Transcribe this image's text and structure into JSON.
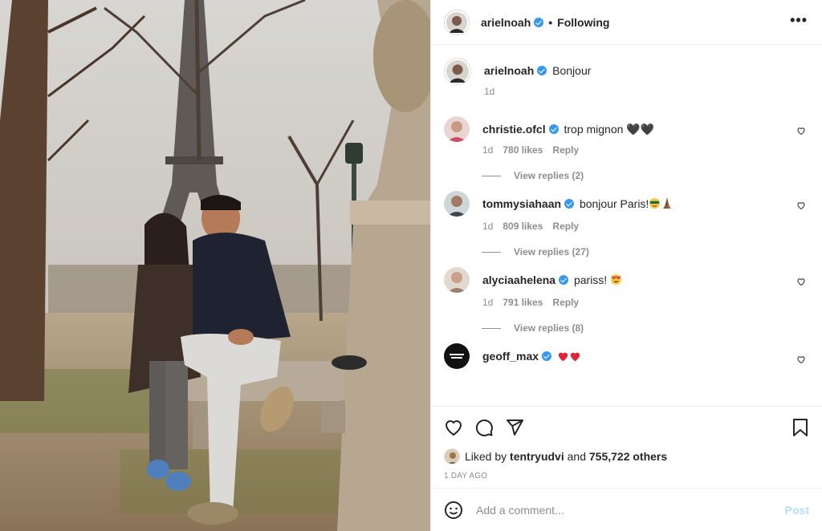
{
  "header": {
    "username": "arielnoah",
    "separator": "•",
    "follow_status": "Following",
    "more_label": "•••"
  },
  "caption": {
    "username": "arielnoah",
    "text": "Bonjour",
    "age": "1d"
  },
  "comments": [
    {
      "username": "christie.ofcl",
      "text": "trop mignon 🖤🖤",
      "age": "1d",
      "likes": "780 likes",
      "reply_label": "Reply",
      "view_replies": "View replies (2)",
      "verified": true
    },
    {
      "username": "tommysiahaan",
      "text": "bonjour Paris!",
      "age": "1d",
      "likes": "809 likes",
      "reply_label": "Reply",
      "view_replies": "View replies (27)",
      "verified": true
    },
    {
      "username": "alyciaahelena",
      "text": "pariss!",
      "age": "1d",
      "likes": "791 likes",
      "reply_label": "Reply",
      "view_replies": "View replies (8)",
      "verified": true
    },
    {
      "username": "geoff_max",
      "text": "",
      "verified": true
    }
  ],
  "likes": {
    "prefix": "Liked by",
    "user": "tentryudvi",
    "conj": "and",
    "others": "755,722 others"
  },
  "timestamp": "1 DAY AGO",
  "add_comment": {
    "placeholder": "Add a comment...",
    "post_label": "Post"
  },
  "colors": {
    "verified": "#3897f0",
    "post_disabled": "#b2dffc",
    "muted": "#8e8e8e",
    "heart_red": "#ed4956"
  },
  "icons": [
    "heart-icon",
    "comment-icon",
    "share-icon",
    "bookmark-icon",
    "emoji-icon",
    "more-icon",
    "verified-icon"
  ]
}
